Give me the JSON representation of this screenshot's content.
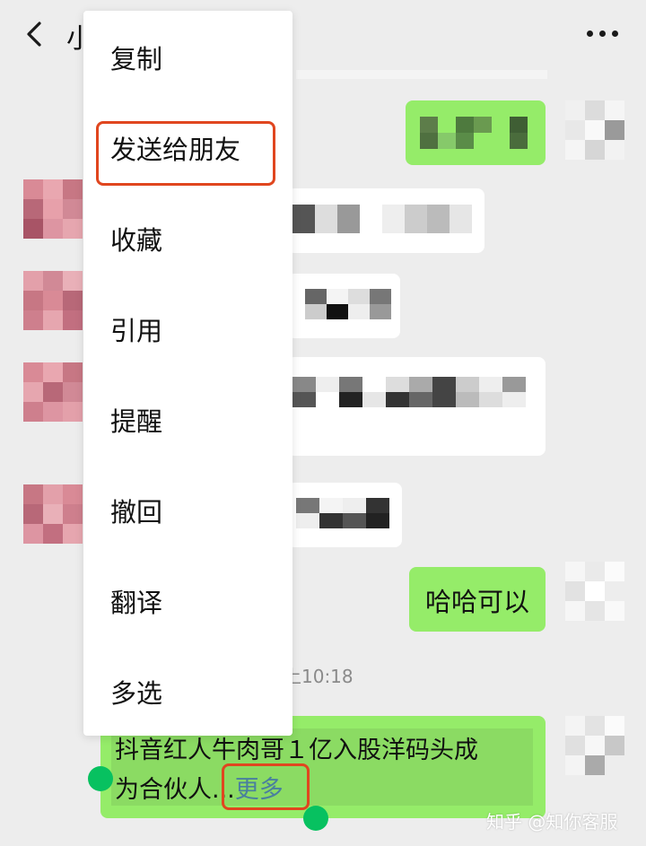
{
  "header": {
    "title_visible": "小",
    "back_icon": "chevron-left-icon",
    "more_icon": "ellipsis-icon"
  },
  "context_menu": {
    "items": [
      {
        "label": "复制"
      },
      {
        "label": "发送给朋友",
        "highlighted": true
      },
      {
        "label": "收藏"
      },
      {
        "label": "引用"
      },
      {
        "label": "提醒"
      },
      {
        "label": "撤回"
      },
      {
        "label": "翻译"
      },
      {
        "label": "多选"
      }
    ]
  },
  "messages": {
    "reply_text": "哈哈可以",
    "timestamp_partial": "上10:18",
    "selected_message": {
      "line1": "抖音红人牛肉哥１亿入股洋码头成",
      "line2_prefix": "为合伙人",
      "ellipsis": "...",
      "more_label": "更多"
    }
  },
  "watermark": "知乎 @知你客服",
  "colors": {
    "background": "#ededed",
    "green_bubble": "#95ec69",
    "highlight": "#e0461f",
    "selection_handle": "#07c160",
    "more_link": "#4a7f9e"
  }
}
